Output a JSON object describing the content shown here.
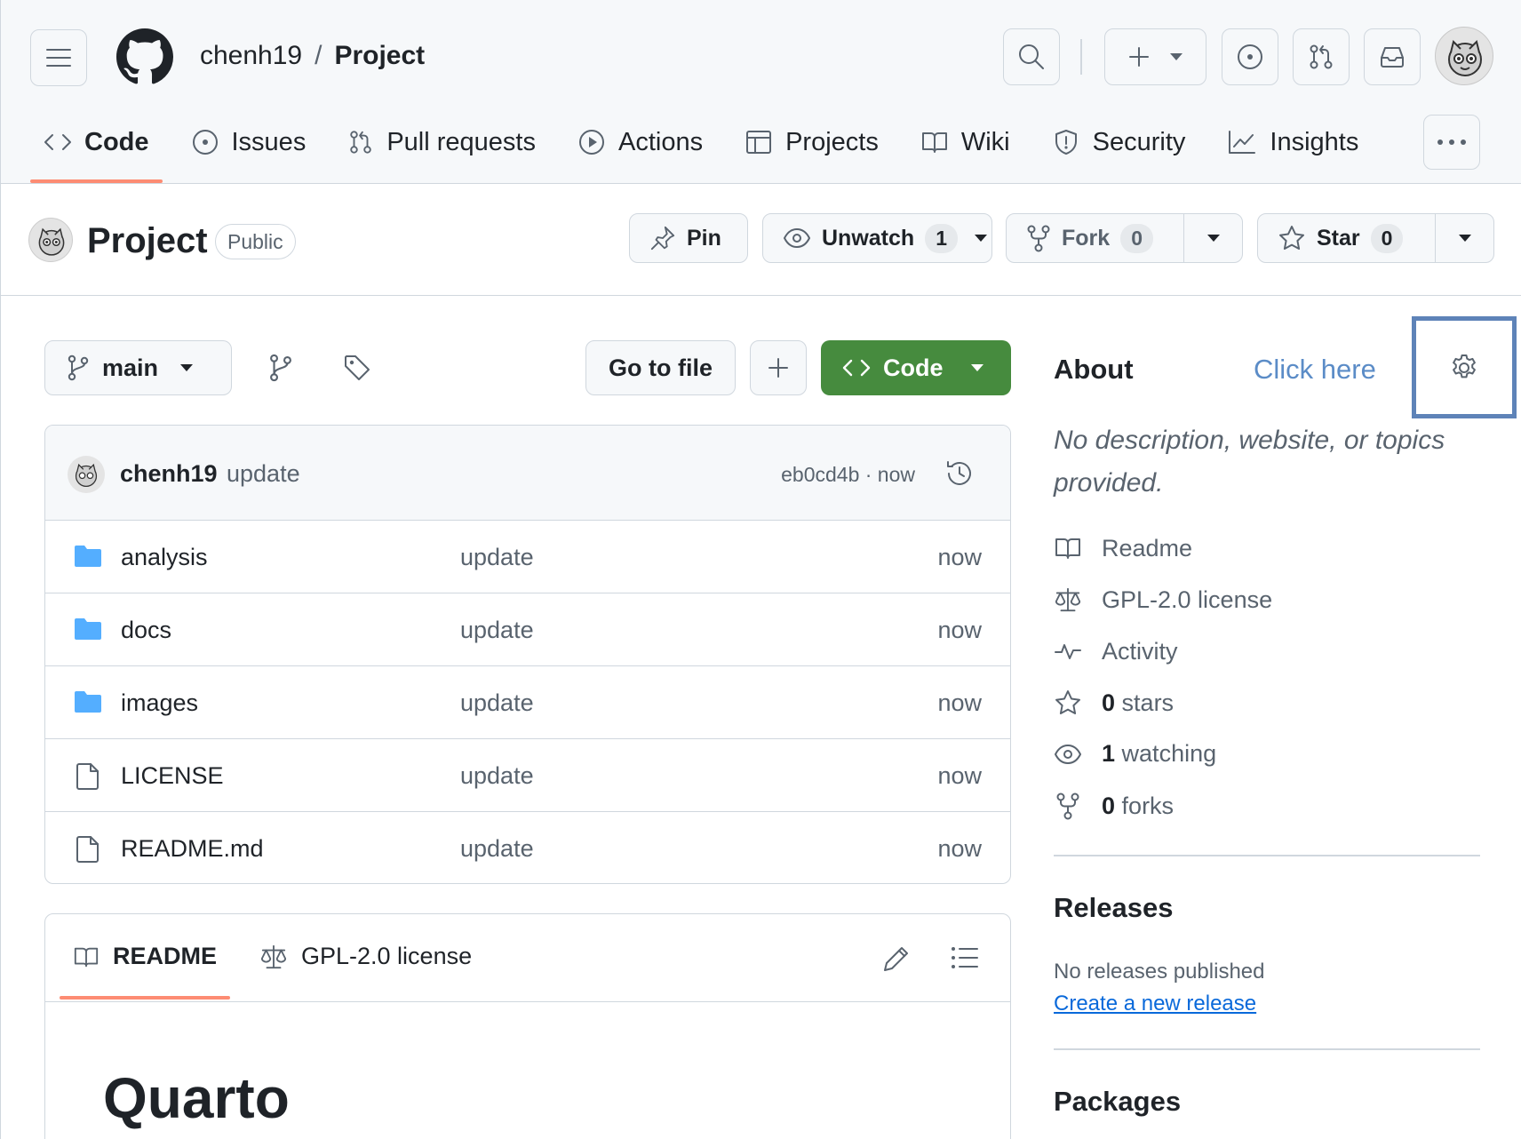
{
  "header": {
    "owner": "chenh19",
    "separator": "/",
    "repo": "Project"
  },
  "nav": {
    "tabs": [
      {
        "label": "Code",
        "icon": "code-icon",
        "active": true
      },
      {
        "label": "Issues",
        "icon": "issue-circle-icon"
      },
      {
        "label": "Pull requests",
        "icon": "pull-request-icon"
      },
      {
        "label": "Actions",
        "icon": "play-icon"
      },
      {
        "label": "Projects",
        "icon": "table-icon"
      },
      {
        "label": "Wiki",
        "icon": "book-icon"
      },
      {
        "label": "Security",
        "icon": "shield-icon"
      },
      {
        "label": "Insights",
        "icon": "graph-icon"
      }
    ]
  },
  "repo_head": {
    "title": "Project",
    "visibility": "Public",
    "pin_label": "Pin",
    "watch_label": "Unwatch",
    "watch_count": "1",
    "fork_label": "Fork",
    "fork_count": "0",
    "star_label": "Star",
    "star_count": "0"
  },
  "toolbar": {
    "branch": "main",
    "go_to_file": "Go to file",
    "code_label": "Code"
  },
  "commit": {
    "author": "chenh19",
    "message": "update",
    "hash_time": "eb0cd4b · now"
  },
  "files": [
    {
      "name": "analysis",
      "type": "folder",
      "message": "update",
      "time": "now"
    },
    {
      "name": "docs",
      "type": "folder",
      "message": "update",
      "time": "now"
    },
    {
      "name": "images",
      "type": "folder",
      "message": "update",
      "time": "now"
    },
    {
      "name": "LICENSE",
      "type": "file",
      "message": "update",
      "time": "now"
    },
    {
      "name": "README.md",
      "type": "file",
      "message": "update",
      "time": "now"
    }
  ],
  "readme": {
    "tab_readme": "README",
    "tab_license": "GPL-2.0 license",
    "heading": "Quarto"
  },
  "sidebar": {
    "about_title": "About",
    "click_here": "Click here",
    "description": "No description, website, or topics provided.",
    "items": [
      {
        "icon": "book-icon",
        "bold": "",
        "text": "Readme"
      },
      {
        "icon": "law-icon",
        "bold": "",
        "text": "GPL-2.0 license"
      },
      {
        "icon": "pulse-icon",
        "bold": "",
        "text": "Activity"
      },
      {
        "icon": "star-icon",
        "bold": "0",
        "text": "stars"
      },
      {
        "icon": "eye-icon",
        "bold": "1",
        "text": "watching"
      },
      {
        "icon": "fork-icon",
        "bold": "0",
        "text": "forks"
      }
    ],
    "releases_title": "Releases",
    "no_releases": "No releases published",
    "create_release": "Create a new release",
    "packages_title": "Packages"
  },
  "colors": {
    "accent_underline": "#fd8c73",
    "code_button": "#468b3e",
    "link": "#0969da",
    "highlight_box": "#5e83b8",
    "folder": "#54aeff"
  }
}
